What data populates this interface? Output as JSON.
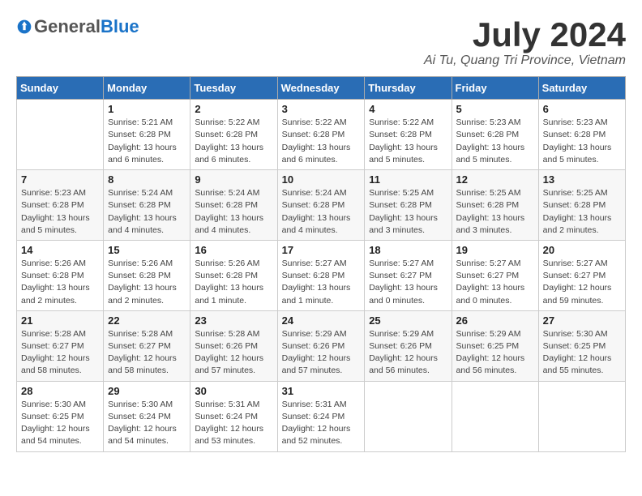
{
  "header": {
    "logo_general": "General",
    "logo_blue": "Blue",
    "month_title": "July 2024",
    "location": "Ai Tu, Quang Tri Province, Vietnam"
  },
  "days_of_week": [
    "Sunday",
    "Monday",
    "Tuesday",
    "Wednesday",
    "Thursday",
    "Friday",
    "Saturday"
  ],
  "weeks": [
    [
      {
        "day": "",
        "info": ""
      },
      {
        "day": "1",
        "info": "Sunrise: 5:21 AM\nSunset: 6:28 PM\nDaylight: 13 hours\nand 6 minutes."
      },
      {
        "day": "2",
        "info": "Sunrise: 5:22 AM\nSunset: 6:28 PM\nDaylight: 13 hours\nand 6 minutes."
      },
      {
        "day": "3",
        "info": "Sunrise: 5:22 AM\nSunset: 6:28 PM\nDaylight: 13 hours\nand 6 minutes."
      },
      {
        "day": "4",
        "info": "Sunrise: 5:22 AM\nSunset: 6:28 PM\nDaylight: 13 hours\nand 5 minutes."
      },
      {
        "day": "5",
        "info": "Sunrise: 5:23 AM\nSunset: 6:28 PM\nDaylight: 13 hours\nand 5 minutes."
      },
      {
        "day": "6",
        "info": "Sunrise: 5:23 AM\nSunset: 6:28 PM\nDaylight: 13 hours\nand 5 minutes."
      }
    ],
    [
      {
        "day": "7",
        "info": "Sunrise: 5:23 AM\nSunset: 6:28 PM\nDaylight: 13 hours\nand 5 minutes."
      },
      {
        "day": "8",
        "info": "Sunrise: 5:24 AM\nSunset: 6:28 PM\nDaylight: 13 hours\nand 4 minutes."
      },
      {
        "day": "9",
        "info": "Sunrise: 5:24 AM\nSunset: 6:28 PM\nDaylight: 13 hours\nand 4 minutes."
      },
      {
        "day": "10",
        "info": "Sunrise: 5:24 AM\nSunset: 6:28 PM\nDaylight: 13 hours\nand 4 minutes."
      },
      {
        "day": "11",
        "info": "Sunrise: 5:25 AM\nSunset: 6:28 PM\nDaylight: 13 hours\nand 3 minutes."
      },
      {
        "day": "12",
        "info": "Sunrise: 5:25 AM\nSunset: 6:28 PM\nDaylight: 13 hours\nand 3 minutes."
      },
      {
        "day": "13",
        "info": "Sunrise: 5:25 AM\nSunset: 6:28 PM\nDaylight: 13 hours\nand 2 minutes."
      }
    ],
    [
      {
        "day": "14",
        "info": "Sunrise: 5:26 AM\nSunset: 6:28 PM\nDaylight: 13 hours\nand 2 minutes."
      },
      {
        "day": "15",
        "info": "Sunrise: 5:26 AM\nSunset: 6:28 PM\nDaylight: 13 hours\nand 2 minutes."
      },
      {
        "day": "16",
        "info": "Sunrise: 5:26 AM\nSunset: 6:28 PM\nDaylight: 13 hours\nand 1 minute."
      },
      {
        "day": "17",
        "info": "Sunrise: 5:27 AM\nSunset: 6:28 PM\nDaylight: 13 hours\nand 1 minute."
      },
      {
        "day": "18",
        "info": "Sunrise: 5:27 AM\nSunset: 6:27 PM\nDaylight: 13 hours\nand 0 minutes."
      },
      {
        "day": "19",
        "info": "Sunrise: 5:27 AM\nSunset: 6:27 PM\nDaylight: 13 hours\nand 0 minutes."
      },
      {
        "day": "20",
        "info": "Sunrise: 5:27 AM\nSunset: 6:27 PM\nDaylight: 12 hours\nand 59 minutes."
      }
    ],
    [
      {
        "day": "21",
        "info": "Sunrise: 5:28 AM\nSunset: 6:27 PM\nDaylight: 12 hours\nand 58 minutes."
      },
      {
        "day": "22",
        "info": "Sunrise: 5:28 AM\nSunset: 6:27 PM\nDaylight: 12 hours\nand 58 minutes."
      },
      {
        "day": "23",
        "info": "Sunrise: 5:28 AM\nSunset: 6:26 PM\nDaylight: 12 hours\nand 57 minutes."
      },
      {
        "day": "24",
        "info": "Sunrise: 5:29 AM\nSunset: 6:26 PM\nDaylight: 12 hours\nand 57 minutes."
      },
      {
        "day": "25",
        "info": "Sunrise: 5:29 AM\nSunset: 6:26 PM\nDaylight: 12 hours\nand 56 minutes."
      },
      {
        "day": "26",
        "info": "Sunrise: 5:29 AM\nSunset: 6:25 PM\nDaylight: 12 hours\nand 56 minutes."
      },
      {
        "day": "27",
        "info": "Sunrise: 5:30 AM\nSunset: 6:25 PM\nDaylight: 12 hours\nand 55 minutes."
      }
    ],
    [
      {
        "day": "28",
        "info": "Sunrise: 5:30 AM\nSunset: 6:25 PM\nDaylight: 12 hours\nand 54 minutes."
      },
      {
        "day": "29",
        "info": "Sunrise: 5:30 AM\nSunset: 6:24 PM\nDaylight: 12 hours\nand 54 minutes."
      },
      {
        "day": "30",
        "info": "Sunrise: 5:31 AM\nSunset: 6:24 PM\nDaylight: 12 hours\nand 53 minutes."
      },
      {
        "day": "31",
        "info": "Sunrise: 5:31 AM\nSunset: 6:24 PM\nDaylight: 12 hours\nand 52 minutes."
      },
      {
        "day": "",
        "info": ""
      },
      {
        "day": "",
        "info": ""
      },
      {
        "day": "",
        "info": ""
      }
    ]
  ]
}
